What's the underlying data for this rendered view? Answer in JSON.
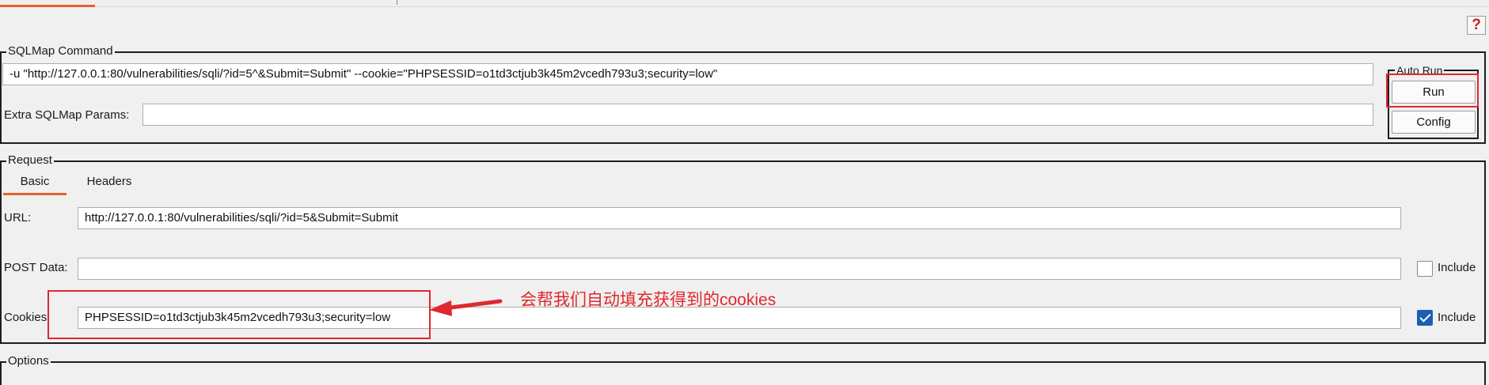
{
  "help_icon_glyph": "?",
  "sqlmap_command": {
    "title": "SQLMap Command",
    "command_value": "-u \"http://127.0.0.1:80/vulnerabilities/sqli/?id=5^&Submit=Submit\" --cookie=\"PHPSESSID=o1td3ctjub3k45m2vcedh793u3;security=low\"",
    "extra_params_label": "Extra SQLMap Params:",
    "extra_params_value": "",
    "auto_run_title": "Auto Run",
    "run_label": "Run",
    "config_label": "Config"
  },
  "request": {
    "title": "Request",
    "tabs": [
      {
        "label": "Basic",
        "active": true
      },
      {
        "label": "Headers",
        "active": false
      }
    ],
    "url_label": "URL:",
    "url_value": "http://127.0.0.1:80/vulnerabilities/sqli/?id=5&Submit=Submit",
    "post_label": "POST Data:",
    "post_value": "",
    "post_include_label": "Include",
    "post_include_checked": false,
    "cookies_label": "Cookies:",
    "cookies_value": "PHPSESSID=o1td3ctjub3k45m2vcedh793u3;security=low",
    "cookies_include_label": "Include",
    "cookies_include_checked": true
  },
  "annotation_text": "会帮我们自动填充获得到的cookies",
  "options": {
    "title": "Options"
  },
  "colors": {
    "accent": "#e8602c",
    "annotation_red": "#e0282e",
    "checkbox_blue": "#1a5fb4"
  }
}
